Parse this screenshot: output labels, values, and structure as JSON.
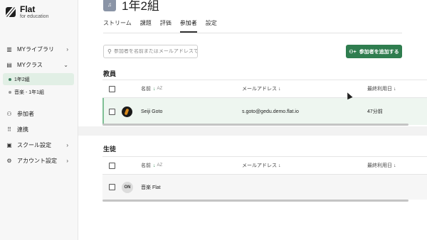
{
  "brand": {
    "title": "Flat",
    "subtitle": "for education"
  },
  "sidebar": {
    "items": [
      {
        "label": "MYライブラリ",
        "icon": "library-icon",
        "chevron": "›"
      },
      {
        "label": "MYクラス",
        "icon": "class-icon",
        "chevron": "⌄"
      }
    ],
    "classes": [
      {
        "label": "1年2組",
        "active": true
      },
      {
        "label": "音楽 - 1年1組",
        "active": false
      }
    ],
    "bottom": [
      {
        "label": "参加者",
        "icon": "people-icon"
      },
      {
        "label": "連携",
        "icon": "apps-grid-icon"
      },
      {
        "label": "スクール設定",
        "icon": "school-icon",
        "chevron": "›"
      },
      {
        "label": "アカウント設定",
        "icon": "gear-icon",
        "chevron": "›"
      }
    ]
  },
  "course": {
    "title": "1年2組"
  },
  "tabs": [
    "ストリーム",
    "課題",
    "評価",
    "参加者",
    "設定"
  ],
  "active_tab": "参加者",
  "search": {
    "placeholder": "参加者を名前またはメールアドレスで"
  },
  "add_button": {
    "label": "参加者を追加する"
  },
  "teachers": {
    "title": "教員",
    "columns": {
      "name": "名前",
      "email": "メールアドレス",
      "last_used": "最終利用日"
    },
    "sort_az": "AZ",
    "rows": [
      {
        "name": "Seiji Goto",
        "email": "s.goto@gedu.demo.flat.io",
        "last_used": "47分前"
      }
    ]
  },
  "students": {
    "title": "生徒",
    "columns": {
      "name": "名前",
      "email": "メールアドレス",
      "last_used": "最終利用日"
    },
    "sort_az": "AZ",
    "rows": [
      {
        "initials": "ON",
        "name": "音楽 Flat",
        "email": "",
        "last_used": ""
      }
    ]
  },
  "colors": {
    "accent": "#2f7d4f",
    "highlight": "#eef6f0",
    "sidebar_bg": "#f7f7f7"
  }
}
